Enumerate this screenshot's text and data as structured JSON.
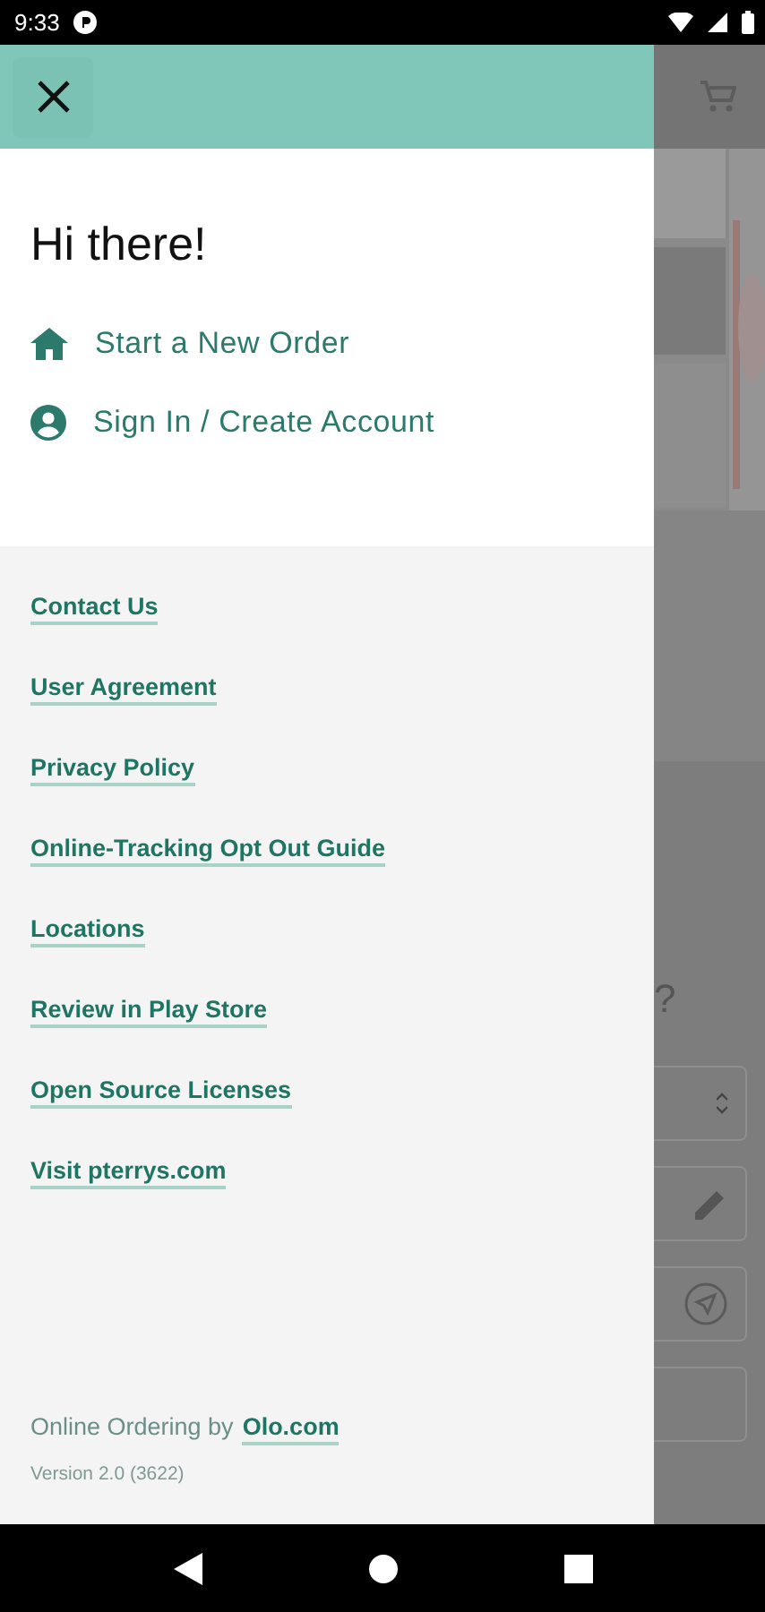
{
  "status_bar": {
    "time": "9:33"
  },
  "drawer": {
    "greeting": "Hi there!",
    "actions": [
      {
        "kind": "home",
        "label": "Start a New Order"
      },
      {
        "kind": "account",
        "label": "Sign In / Create Account"
      }
    ],
    "links": [
      "Contact Us",
      "User Agreement",
      "Privacy Policy",
      "Online-Tracking Opt Out Guide",
      "Locations",
      "Review in Play Store",
      "Open Source Licenses",
      "Visit pterrys.com"
    ],
    "footer": {
      "credit": "Online Ordering by",
      "credit_link": "Olo.com",
      "version": "Version 2.0 (3622)"
    }
  },
  "background": {
    "question_mark": "?"
  }
}
